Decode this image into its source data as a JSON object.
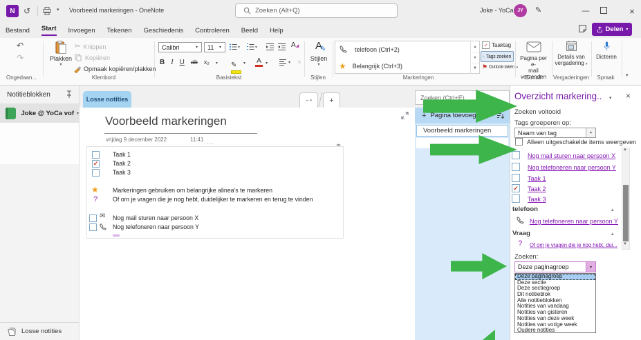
{
  "titlebar": {
    "title": "Voorbeeld markeringen - OneNote",
    "search_placeholder": "Zoeken (Alt+Q)",
    "user_name": "Joke - YoCa",
    "avatar_initials": "JY"
  },
  "menubar": {
    "tabs": [
      "Bestand",
      "Start",
      "Invoegen",
      "Tekenen",
      "Geschiedenis",
      "Controleren",
      "Beeld",
      "Help"
    ],
    "active_tab": "Start",
    "share_label": "Delen"
  },
  "ribbon": {
    "undo_group_label": "Ongedaan...",
    "clipboard": {
      "paste": "Plakken",
      "cut": "Knippen",
      "copy": "Kopiëren",
      "format_painter": "Opmaak kopiëren/plakken",
      "label": "Klembord"
    },
    "basictext": {
      "font_name": "Calibri",
      "font_size": "11",
      "bold": "B",
      "italic": "I",
      "underline": "U",
      "strike": "ab",
      "subscript": "x₂",
      "label": "Basistekst"
    },
    "styles": {
      "button": "Stijlen",
      "label": "Stijlen"
    },
    "tags": {
      "tag_phone": "telefoon (Ctrl+2)",
      "tag_important": "Belangrijk (Ctrl+3)",
      "task_tag": "Taaktag",
      "find_tags": "Tags zoeken",
      "outlook_tasks": "Outlook-taken",
      "label": "Markeringen"
    },
    "email": {
      "line1": "Pagina per e-",
      "line2": "mail verzenden",
      "label": "E-mail"
    },
    "meetings": {
      "line1": "Details van",
      "line2": "vergadering",
      "label": "Vergaderingen"
    },
    "speech": {
      "button": "Dicteren",
      "label": "Spraak"
    }
  },
  "sidebar": {
    "header": "Notitieblokken",
    "notebook": "Joke @ YoCa vof",
    "footer": "Losse notities"
  },
  "section_tabs": {
    "tab": "Losse notities",
    "page_search_placeholder": "Zoeken (Ctrl+E)"
  },
  "page": {
    "title": "Voorbeeld markeringen",
    "date": "vrijdag 9 december 2022",
    "time": "11:41",
    "tasks": [
      {
        "label": "Taak 1",
        "checked": false
      },
      {
        "label": "Taak 2",
        "checked": true
      },
      {
        "label": "Taak 3",
        "checked": false
      }
    ],
    "note_star": "Markeringen gebruiken om belangrijke alinea's te markeren",
    "note_question": "Of om je vragen die je nog hebt, duidelijker te markeren en terug te vinden",
    "todo_mail": "Nog mail sturen naar persoon X",
    "todo_phone": "Nog telefoneren naar persoon Y"
  },
  "pages_panel": {
    "add_page": "Pagina toevoegen",
    "pages": [
      "Voorbeeld markeringen"
    ]
  },
  "tags_panel": {
    "title": "Overzicht markering..",
    "status": "Zoeken voltooid",
    "group_by_label": "Tags groeperen op:",
    "group_by_value": "Naam van tag",
    "show_unchecked_label": "Alleen uitgeschakelde items weergeven",
    "checkbox_items": [
      {
        "label": "Nog mail sturen naar persoon X",
        "checked": false
      },
      {
        "label": "Nog telefoneren naar persoon Y",
        "checked": false
      },
      {
        "label": "Taak 1",
        "checked": false
      },
      {
        "label": "Taak 2",
        "checked": true
      },
      {
        "label": "Taak 3",
        "checked": false
      }
    ],
    "groups": [
      {
        "name": "telefoon",
        "item": "Nog telefoneren naar persoon Y",
        "icon": "phone-icon"
      },
      {
        "name": "Vraag",
        "item": "Of om je vragen die je nog hebt, dui...",
        "icon": "question-icon"
      }
    ],
    "search_label": "Zoeken:",
    "scope_value": "Deze paginagroep",
    "scope_options": [
      "Deze paginagroep",
      "Deze sectie",
      "Deze sectiegroep",
      "Dit notitieblok",
      "Alle notitieblokken",
      "Notities van vandaag",
      "Notities van gisteren",
      "Notities van deze week",
      "Notities van vorige week",
      "Oudere notities"
    ],
    "selected_option": "Deze paginagroep"
  },
  "colors": {
    "accent_purple": "#7719aa",
    "tab_blue": "#a5d3f2",
    "pages_panel_blue": "#d9ebfa",
    "link_purple": "#8314b4",
    "arrow_green": "#3db54a",
    "check_red": "#c0392b",
    "star_orange": "#f0a01e"
  }
}
